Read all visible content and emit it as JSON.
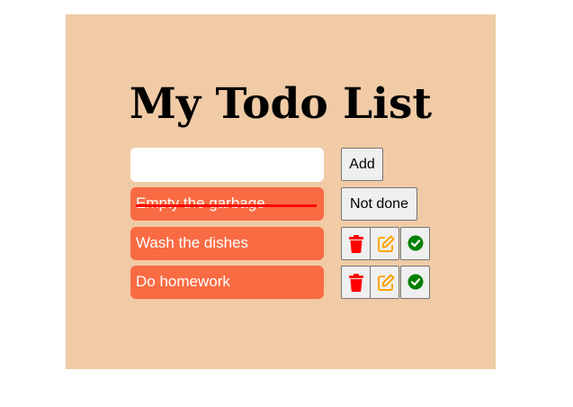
{
  "app": {
    "title": "My Todo List"
  },
  "input": {
    "value": "",
    "placeholder": ""
  },
  "buttons": {
    "add_label": "Add",
    "not_done_label": "Not done"
  },
  "todos": [
    {
      "text": "Empty the garbage",
      "done": true
    },
    {
      "text": "Wash the dishes",
      "done": false
    },
    {
      "text": "Do homework",
      "done": false
    }
  ],
  "colors": {
    "panel_bg": "#f0cba6",
    "item_bg": "#f96b43",
    "strike": "#ff0000",
    "delete_icon": "#ff0000",
    "edit_icon": "#ffa500",
    "complete_icon": "#008000"
  },
  "icons": {
    "delete": "trash-icon",
    "edit": "edit-icon",
    "complete": "check-circle-icon"
  }
}
